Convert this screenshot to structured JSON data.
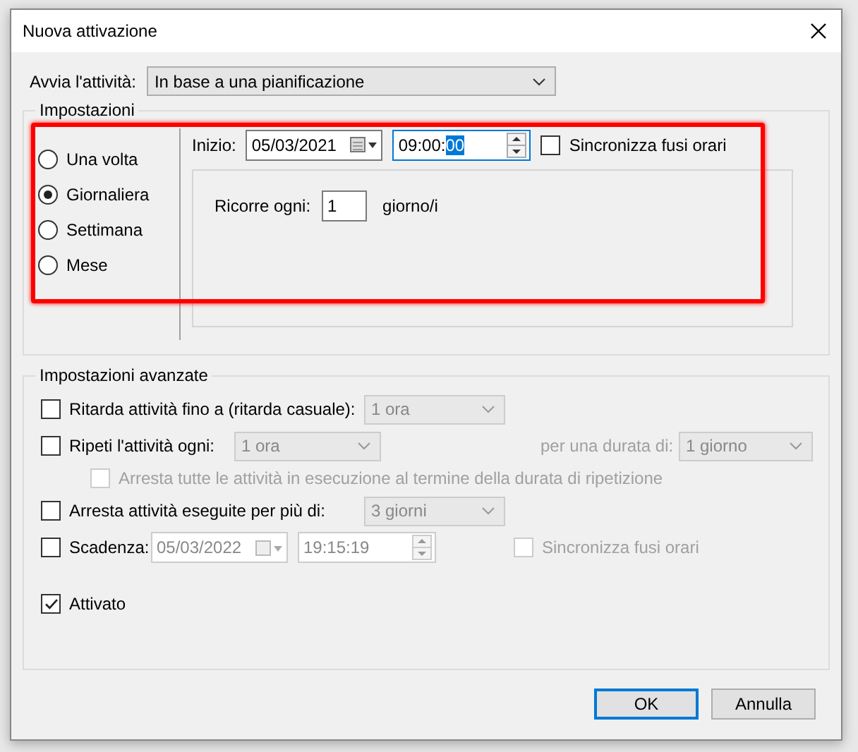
{
  "window": {
    "title": "Nuova attivazione"
  },
  "start_task": {
    "label": "Avvia l'attività:",
    "value": "In base a una pianificazione"
  },
  "settings": {
    "legend": "Impostazioni",
    "frequencies": [
      {
        "label": "Una volta",
        "selected": false
      },
      {
        "label": "Giornaliera",
        "selected": true
      },
      {
        "label": "Settimana",
        "selected": false
      },
      {
        "label": "Mese",
        "selected": false
      }
    ],
    "start": {
      "label": "Inizio:",
      "date": "05/03/2021",
      "time": "09:00:",
      "time_selected": "00"
    },
    "sync_timezones": {
      "label": "Sincronizza fusi orari",
      "checked": false
    },
    "recur": {
      "label": "Ricorre ogni:",
      "value": "1",
      "unit": "giorno/i"
    }
  },
  "advanced": {
    "legend": "Impostazioni avanzate",
    "delay": {
      "label": "Ritarda attività fino a (ritarda casuale):",
      "checked": false,
      "value": "1 ora"
    },
    "repeat": {
      "label": "Ripeti l'attività ogni:",
      "checked": false,
      "value": "1 ora",
      "duration_label": "per una durata di:",
      "duration": "1 giorno"
    },
    "stop_all": {
      "label": "Arresta tutte le attività in esecuzione al termine della durata di ripetizione",
      "checked": false,
      "disabled": true
    },
    "stop_after": {
      "label": "Arresta attività eseguite per più di:",
      "checked": false,
      "value": "3 giorni"
    },
    "expire": {
      "label": "Scadenza:",
      "checked": false,
      "date": "05/03/2022",
      "time": "19:15:19",
      "sync_label": "Sincronizza fusi orari",
      "sync_checked": false
    },
    "enabled": {
      "label": "Attivato",
      "checked": true
    }
  },
  "buttons": [
    {
      "label": "OK",
      "default": true
    },
    {
      "label": "Annulla",
      "default": false
    }
  ]
}
